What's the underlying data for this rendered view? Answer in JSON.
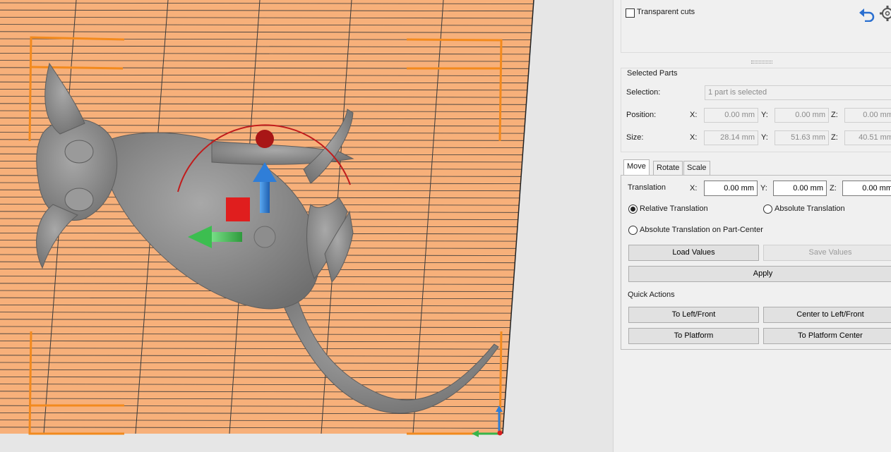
{
  "top_panel": {
    "transparent_cuts_label": "Transparent cuts",
    "transparent_cuts_checked": false,
    "undo_icon": "undo-arrow-icon",
    "settings_icon": "gear-icon"
  },
  "selected_parts": {
    "title": "Selected Parts",
    "selection_label": "Selection:",
    "selection_value": "1 part is selected",
    "position_label": "Position:",
    "size_label": "Size:",
    "axis_x": "X:",
    "axis_y": "Y:",
    "axis_z": "Z:",
    "position": {
      "x": "0.00 mm",
      "y": "0.00 mm",
      "z": "0.00 mm"
    },
    "size": {
      "x": "28.14 mm",
      "y": "51.63 mm",
      "z": "40.51 mm"
    }
  },
  "tabs": [
    {
      "label": "Move",
      "active": true
    },
    {
      "label": "Rotate",
      "active": false
    },
    {
      "label": "Scale",
      "active": false
    }
  ],
  "move": {
    "translation_label": "Translation",
    "axis_x": "X:",
    "axis_y": "Y:",
    "axis_z": "Z:",
    "translation": {
      "x": "0.00 mm",
      "y": "0.00 mm",
      "z": "0.00 mm"
    },
    "relative_label": "Relative Translation",
    "absolute_label": "Absolute Translation",
    "absolute_center_label": "Absolute Translation on Part-Center",
    "selected_mode": "relative",
    "load_values": "Load Values",
    "save_values": "Save Values",
    "apply": "Apply"
  },
  "quick_actions": {
    "title": "Quick Actions",
    "to_left_front": "To Left/Front",
    "center_to_left_front": "Center to Left/Front",
    "to_platform": "To Platform",
    "to_platform_center": "To Platform Center"
  },
  "colors": {
    "platform": "#f7b07a",
    "platform_lines": "#3a3a3a",
    "bounding_box": "#f28a1e",
    "model": "#8c8c8c",
    "gizmo_red": "#d81f1f",
    "gizmo_green": "#38b44a",
    "gizmo_blue": "#2f7ed8"
  }
}
